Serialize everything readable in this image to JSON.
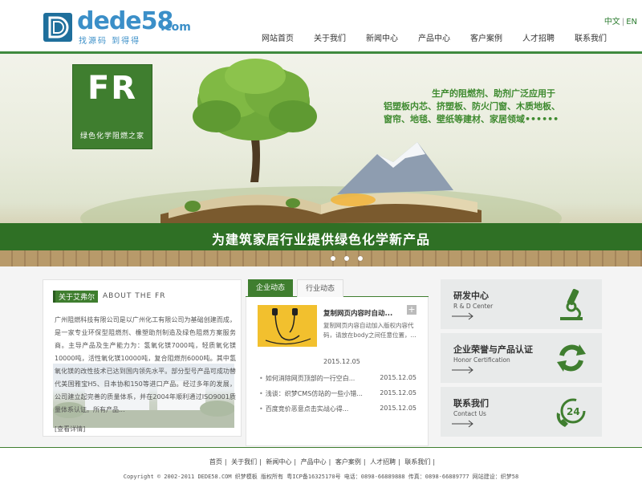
{
  "logo": {
    "text": "dede58",
    "suffix": ".com",
    "slogan": "找源码 到得得"
  },
  "lang": {
    "cn": "中文",
    "en": "EN"
  },
  "nav": [
    "网站首页",
    "关于我们",
    "新闻中心",
    "产品中心",
    "客户案例",
    "人才招聘",
    "联系我们"
  ],
  "banner": {
    "box_title": "FR",
    "box_subtitle": "绿色化学阻燃之家",
    "tagline_line1": "生产的阻燃剂、助剂广泛应用于",
    "tagline_line2": "铝塑板内芯、挤塑板、防火门窗、木质地板、",
    "tagline_line3": "窗帘、地毯、壁纸等建材、家居领域••••••",
    "slogan": "为建筑家居行业提供绿色化学新产品",
    "slide_count": 3
  },
  "about": {
    "tag": "关于艾弗尔",
    "title_en": "ABOUT THE FR",
    "text": "广州阻燃科技有限公司是以广州化工有限公司为基础创建而成，是一家专业环保型阻燃剂、橡塑助剂制造及绿色阻燃方案服务商。主导产品及生产能力为：氢氧化镁7000吨，轻质氧化镁10000吨，活性氧化镁10000吨，复合阻燃剂6000吨。其中氢氧化镁的改性技术已达到国内领先水平。部分型号产品可成功替代美国雅宝H5、日本协和150等进口产品。经过多年的发展，公司建立起完善的质量体系，并在2004年顺利通过ISO9001质量体系认证。所有产品...",
    "more": "[查看详情]"
  },
  "news": {
    "tab_active": "企业动态",
    "tab_inactive": "行业动态",
    "featured_title": "复制网页内容时自动...",
    "featured_desc": "复制网页内容自动加入版权内容代码，请放在body之间任意位置，...",
    "featured_date": "2015.12.05",
    "plus": "+",
    "items": [
      {
        "title": "如何消除网页顶部的一行空白...",
        "date": "2015.12.05"
      },
      {
        "title": "浅谈：织梦CMS仿站的一些小错...",
        "date": "2015.12.05"
      },
      {
        "title": "百度竞价恶意点击实战心得...",
        "date": "2015.12.05"
      }
    ]
  },
  "services": [
    {
      "title": "研发中心",
      "en": "R & D Center",
      "icon": "microscope-icon"
    },
    {
      "title": "企业荣誉与产品认证",
      "en": "Honor Certification",
      "icon": "refresh-icon"
    },
    {
      "title": "联系我们",
      "en": "Contact Us",
      "icon": "phone-24-icon",
      "badge": "24"
    }
  ],
  "footer": {
    "links": [
      "首页",
      "关于我们",
      "新闻中心",
      "产品中心",
      "客户案例",
      "人才招聘",
      "联系我们"
    ],
    "copyright": "Copyright © 2002-2011 DEDE58.COM 织梦模板 版权所有   粤ICP备16325170号   电话：0898-66889888 传真：0898-66889777   网站建设：织梦58"
  },
  "colors": {
    "brand_green": "#3f7e2f",
    "logo_blue": "#3b8fc8"
  }
}
